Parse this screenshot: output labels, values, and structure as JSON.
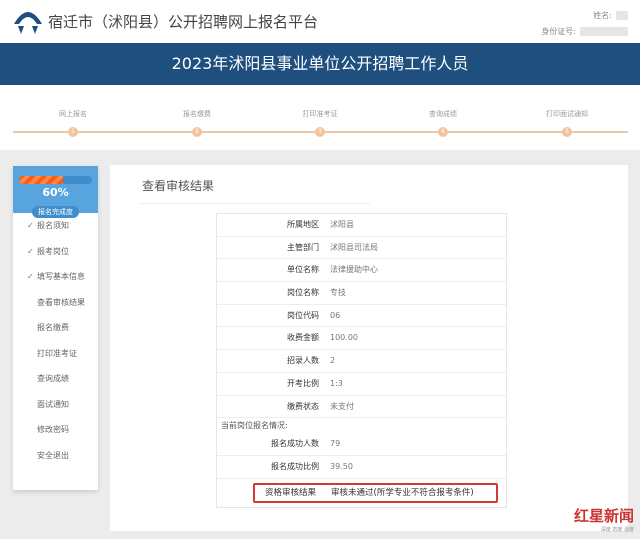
{
  "header": {
    "site_title": "宿迁市（沭阳县）公开招聘网上报名平台",
    "name_label": "姓名:",
    "id_label": "身份证号:"
  },
  "banner": {
    "title": "2023年沭阳县事业单位公开招聘工作人员"
  },
  "steps": [
    {
      "label": "网上报名",
      "num": "1"
    },
    {
      "label": "报名缴费",
      "num": "2"
    },
    {
      "label": "打印准考证",
      "num": "3"
    },
    {
      "label": "查询成绩",
      "num": "4"
    },
    {
      "label": "打印面试通知",
      "num": "5"
    }
  ],
  "sidebar": {
    "progress": 0.6,
    "progress_text": "60%",
    "progress_label": "报名完成度",
    "items": [
      {
        "label": "报名须知",
        "done": true
      },
      {
        "label": "报考岗位",
        "done": true
      },
      {
        "label": "填写基本信息",
        "done": true
      },
      {
        "label": "查看审核结果"
      },
      {
        "label": "报名缴费"
      },
      {
        "label": "打印准考证"
      },
      {
        "label": "查询成绩"
      },
      {
        "label": "面试通知"
      },
      {
        "label": "修改密码"
      },
      {
        "label": "安全退出"
      }
    ],
    "check": "✓"
  },
  "main": {
    "title": "查看审核结果",
    "rows": [
      {
        "k": "所属地区",
        "v": "沭阳县"
      },
      {
        "k": "主管部门",
        "v": "沭阳县司法局"
      },
      {
        "k": "单位名称",
        "v": "法律援助中心"
      },
      {
        "k": "岗位名称",
        "v": "专技"
      },
      {
        "k": "岗位代码",
        "v": "06"
      },
      {
        "k": "收费金额",
        "v": "100.00"
      },
      {
        "k": "招录人数",
        "v": "2"
      },
      {
        "k": "开考比例",
        "v": "1:3"
      },
      {
        "k": "缴费状态",
        "v": "未支付"
      }
    ],
    "section": "当前岗位报名情况:",
    "stats": [
      {
        "k": "报名成功人数",
        "v": "79"
      },
      {
        "k": "报名成功比例",
        "v": "39.50"
      }
    ],
    "result": {
      "k": "资格审核结果",
      "v": "审核未通过(所学专业不符合报考条件)"
    }
  },
  "watermark": {
    "text": "红星新闻"
  },
  "colors": {
    "banner": "#1e4f7f",
    "sidebar_top": "#58a4df",
    "highlight": "#d23a3a"
  }
}
